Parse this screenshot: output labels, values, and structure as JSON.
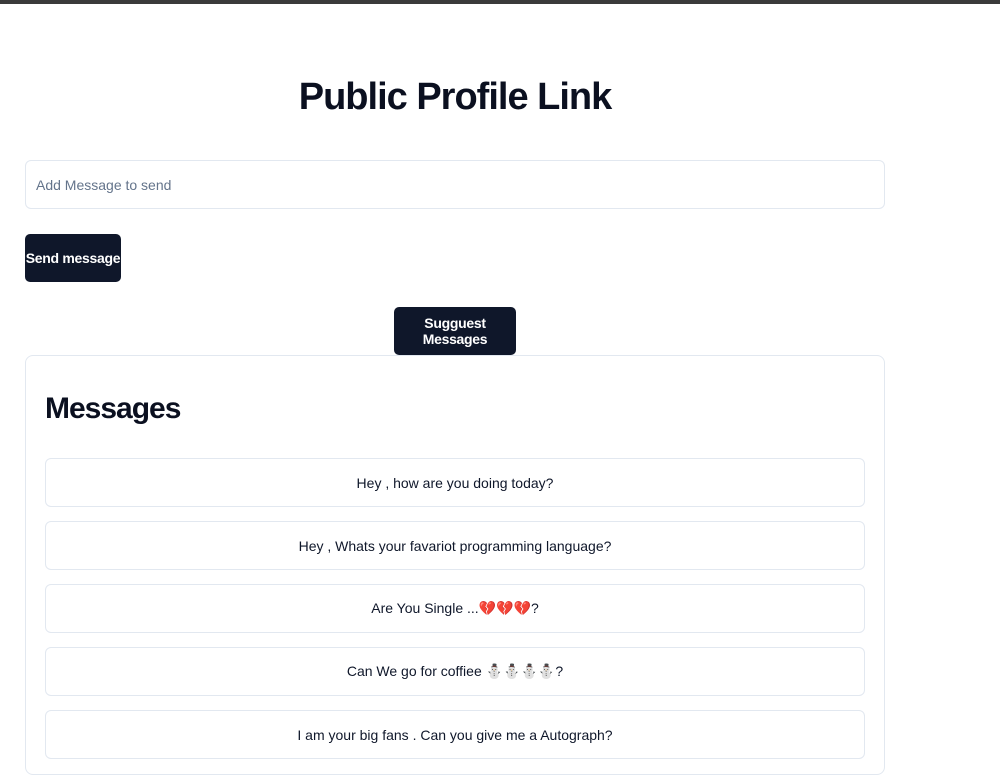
{
  "page": {
    "title": "Public Profile Link"
  },
  "compose": {
    "placeholder": "Add Message to send",
    "value": "",
    "send_label": "Send message"
  },
  "suggest": {
    "label": "Sugguest Messages"
  },
  "messages_card": {
    "title": "Messages",
    "items": [
      "Hey , how are you doing today?",
      "Hey , Whats your favariot programming language?",
      "Are You Single ...💔💔💔?",
      "Can We go for coffiee ⛄⛄⛄⛄?",
      "I am your big fans . Can you give me a Autograph?"
    ]
  },
  "colors": {
    "primary_button": "#0f172a",
    "border": "#e2e8f0",
    "placeholder": "#64748b"
  }
}
